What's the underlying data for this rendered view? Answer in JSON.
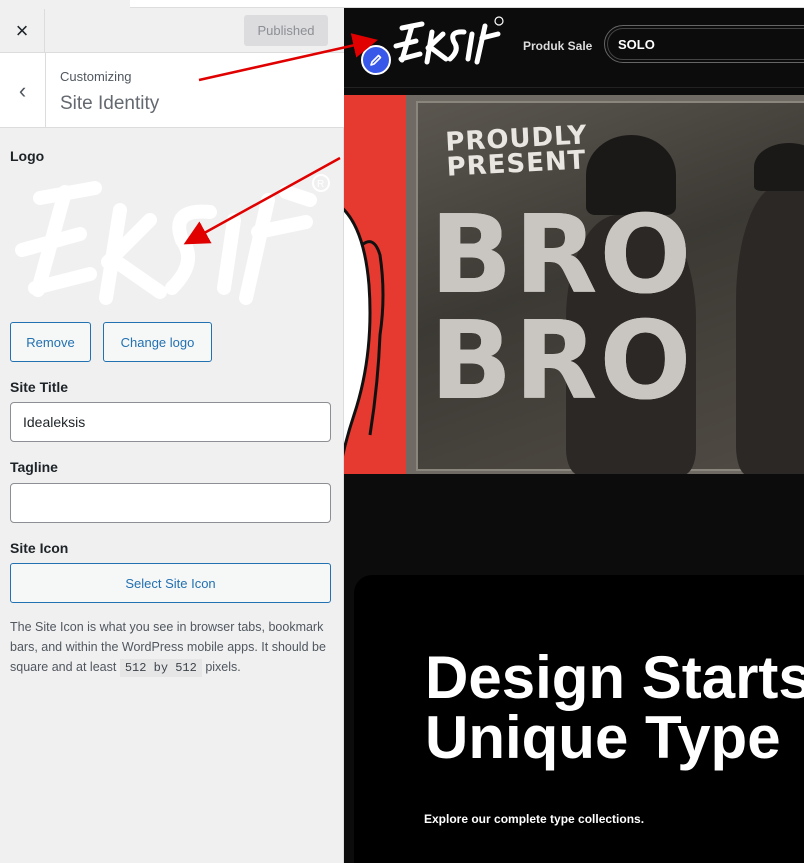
{
  "topbar": {
    "close_icon": "×",
    "publish_label": "Published"
  },
  "section": {
    "back_icon": "‹",
    "crumb": "Customizing",
    "title": "Site Identity"
  },
  "logo": {
    "label": "Logo",
    "remove_label": "Remove",
    "change_label": "Change logo"
  },
  "site_title": {
    "label": "Site Title",
    "value": "Idealeksis"
  },
  "tagline": {
    "label": "Tagline",
    "value": ""
  },
  "site_icon": {
    "label": "Site Icon",
    "select_label": "Select Site Icon",
    "desc_before": "The Site Icon is what you see in browser tabs, bookmark bars, and within the WordPress mobile apps. It should be square and at least",
    "desc_code": "512 by 512",
    "desc_after": "pixels."
  },
  "preview": {
    "nav_link": "Produk Sale",
    "nav_pill": "SOLO",
    "hero_small": "PROUDLY\nPRESENT",
    "hero_big": "BRO\nBRO",
    "headline": "Design Starts\nUnique Type",
    "subtext": "Explore our complete type collections."
  },
  "colors": {
    "accent": "#2271b1",
    "edit_badge": "#3858e9",
    "hero_red": "#e6392f",
    "arrow": "#e00000"
  }
}
